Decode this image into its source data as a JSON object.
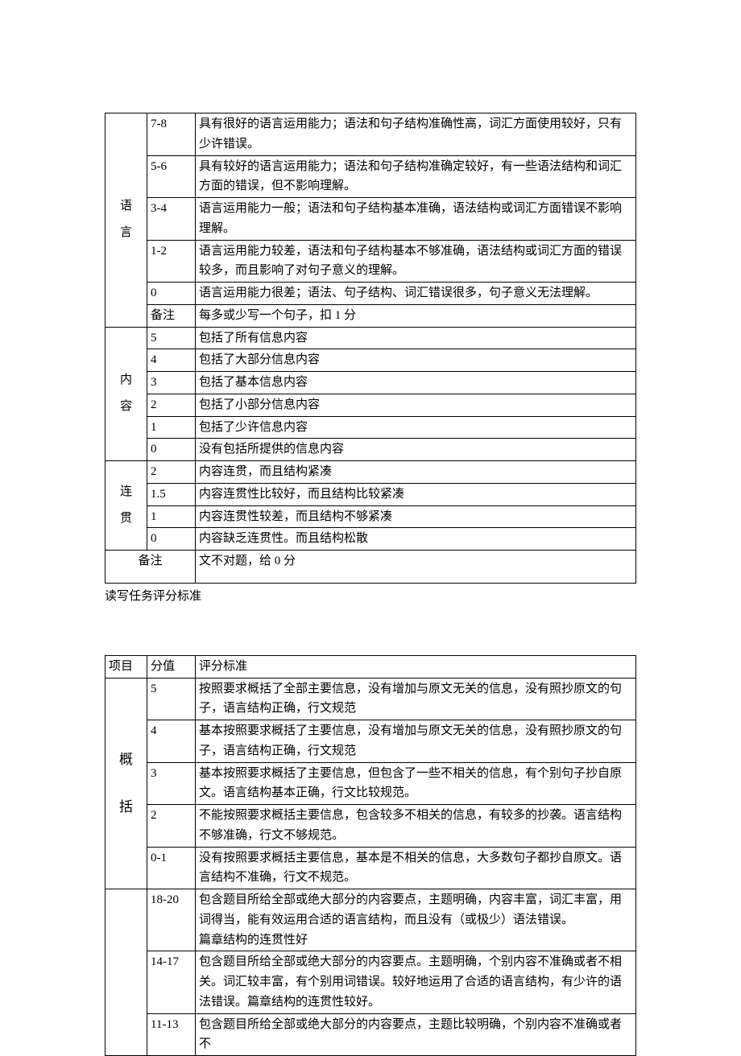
{
  "table1": {
    "categories": {
      "lang": "语\n言",
      "content": "内\n容",
      "coherence": "连\n贯"
    },
    "lang": [
      {
        "score": "7-8",
        "desc": "具有很好的语言运用能力；语法和句子结构准确性高，词汇方面使用较好，只有少许错误。"
      },
      {
        "score": "5-6",
        "desc": "具有较好的语言运用能力；语法和句子结构准确定较好，有一些语法结构和词汇方面的错误，但不影响理解。"
      },
      {
        "score": "3-4",
        "desc": "语言运用能力一般；语法和句子结构基本准确，语法结构或词汇方面错误不影响理解。"
      },
      {
        "score": "1-2",
        "desc": "语言运用能力较差，语法和句子结构基本不够准确，语法结构或词汇方面的错误较多，而且影响了对句子意义的理解。"
      },
      {
        "score": "0",
        "desc": "语言运用能力很差；语法、句子结构、词汇错误很多，句子意义无法理解。"
      },
      {
        "score": "备注",
        "desc": "每多或少写一个句子，扣 1 分"
      }
    ],
    "content": [
      {
        "score": "5",
        "desc": "包括了所有信息内容"
      },
      {
        "score": "4",
        "desc": "包括了大部分信息内容"
      },
      {
        "score": "3",
        "desc": "包括了基本信息内容"
      },
      {
        "score": "2",
        "desc": "包括了小部分信息内容"
      },
      {
        "score": "1",
        "desc": "包括了少许信息内容"
      },
      {
        "score": "0",
        "desc": "没有包括所提供的信息内容"
      }
    ],
    "coherence": [
      {
        "score": "2",
        "desc": "内容连贯，而且结构紧凑"
      },
      {
        "score": "1.5",
        "desc": "内容连贯性比较好，而且结构比较紧凑"
      },
      {
        "score": "1",
        "desc": "内容连贯性较差，而且结构不够紧凑"
      },
      {
        "score": "0",
        "desc": "内容缺乏连贯性。而且结构松散"
      }
    ],
    "footer": {
      "label": "备注",
      "text": "文不对题，给 0 分"
    }
  },
  "caption": "读写任务评分标准",
  "table2": {
    "header": {
      "c1": "项目",
      "c2": "分值",
      "c3": "评分标准"
    },
    "cat": "概\n括",
    "summary": [
      {
        "score": "5",
        "desc": "按照要求概括了全部主要信息，没有增加与原文无关的信息，没有照抄原文的句子，语言结构正确，行文规范"
      },
      {
        "score": "4",
        "desc": "基本按照要求概括了主要信息，没有增加与原文无关的信息，没有照抄原文的句子，语言结构正确，行文规范"
      },
      {
        "score": "3",
        "desc": "基本按照要求概括了主要信息，但包含了一些不相关的信息，有个别句子抄自原文。语言结构基本正确，行文比较规范。"
      },
      {
        "score": "2",
        "desc": "不能按照要求概括主要信息，包含较多不相关的信息，有较多的抄袭。语言结构不够准确，行文不够规范。"
      },
      {
        "score": "0-1",
        "desc": "没有按照要求概括主要信息，基本是不相关的信息，大多数句子都抄自原文。语言结构不准确，行文不规范。"
      }
    ],
    "writing": [
      {
        "score": "18-20",
        "desc": "包含题目所给全部或绝大部分的内容要点，主题明确，内容丰富，词汇丰富，用词得当，能有效运用合适的语言结构，而且没有（或极少）语法错误。\n篇章结构的连贯性好"
      },
      {
        "score": "14-17",
        "desc": "包含题目所给全部或绝大部分的内容要点。主题明确，个别内容不准确或者不相关。词汇较丰富，有个别用词错误。较好地运用了合适的语言结构，有少许的语法错误。篇章结构的连贯性较好。"
      },
      {
        "score": "11-13",
        "desc": "包含题目所给全部或绝大部分的内容要点，主题比较明确，个别内容不准确或者不"
      }
    ]
  }
}
